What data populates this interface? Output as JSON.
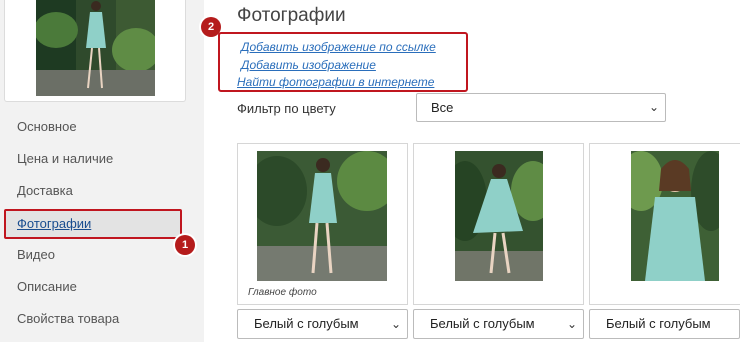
{
  "sidebar": {
    "items": [
      {
        "label": "Основное"
      },
      {
        "label": "Цена и наличие"
      },
      {
        "label": "Доставка"
      },
      {
        "label": "Фотографии"
      },
      {
        "label": "Видео"
      },
      {
        "label": "Описание"
      },
      {
        "label": "Свойства товара"
      }
    ],
    "active_index": 3
  },
  "badges": {
    "first": "1",
    "second": "2"
  },
  "main": {
    "title": "Фотографии",
    "links": {
      "add_by_url": "Добавить изображение по ссылке",
      "add_image": "Добавить изображение",
      "find_online": "Найти фотографии в интернете"
    },
    "filter": {
      "label": "Фильтр по цвету",
      "value": "Все"
    },
    "photos": [
      {
        "caption": "Главное фото",
        "color": "Белый с голубым"
      },
      {
        "caption": "",
        "color": "Белый с голубым"
      },
      {
        "caption": "",
        "color": "Белый с голубым"
      }
    ]
  },
  "colors": {
    "accent_red": "#c0161f",
    "link_blue": "#2a6ebb",
    "sidebar_bg": "#f2f2f2"
  }
}
